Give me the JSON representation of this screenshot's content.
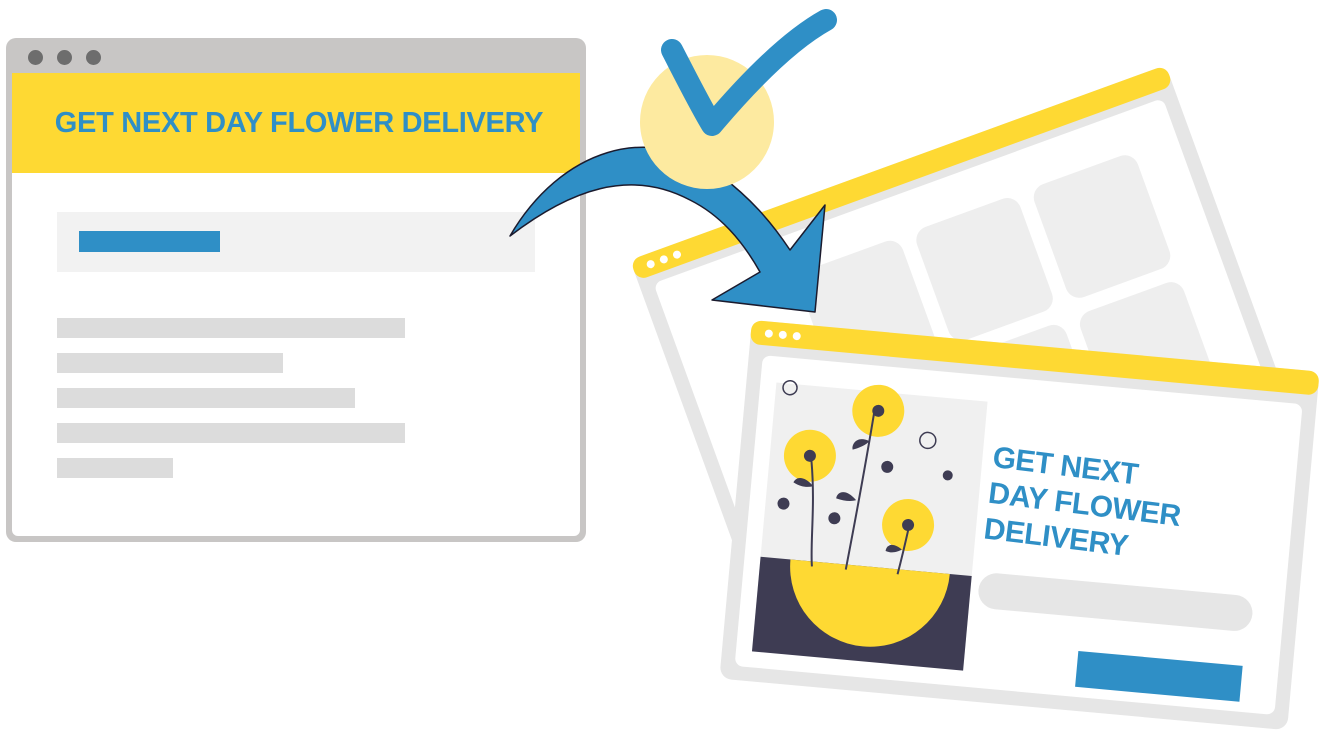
{
  "before_page": {
    "headline": "GET NEXT DAY FLOWER DELIVERY"
  },
  "after_page": {
    "headline_lines": [
      "GET NEXT",
      "DAY FLOWER",
      "DELIVERY"
    ]
  },
  "colors": {
    "brand_blue": "#2f8fc6",
    "brand_yellow": "#fed933",
    "dark_navy": "#3e3c53",
    "window_gray": "#e6e6e6",
    "pale_yellow": "#fdeaa0"
  },
  "icons": {
    "arrow": "curved-arrow-icon",
    "check": "checkmark-icon",
    "flowers": "flower-pot-illustration"
  }
}
